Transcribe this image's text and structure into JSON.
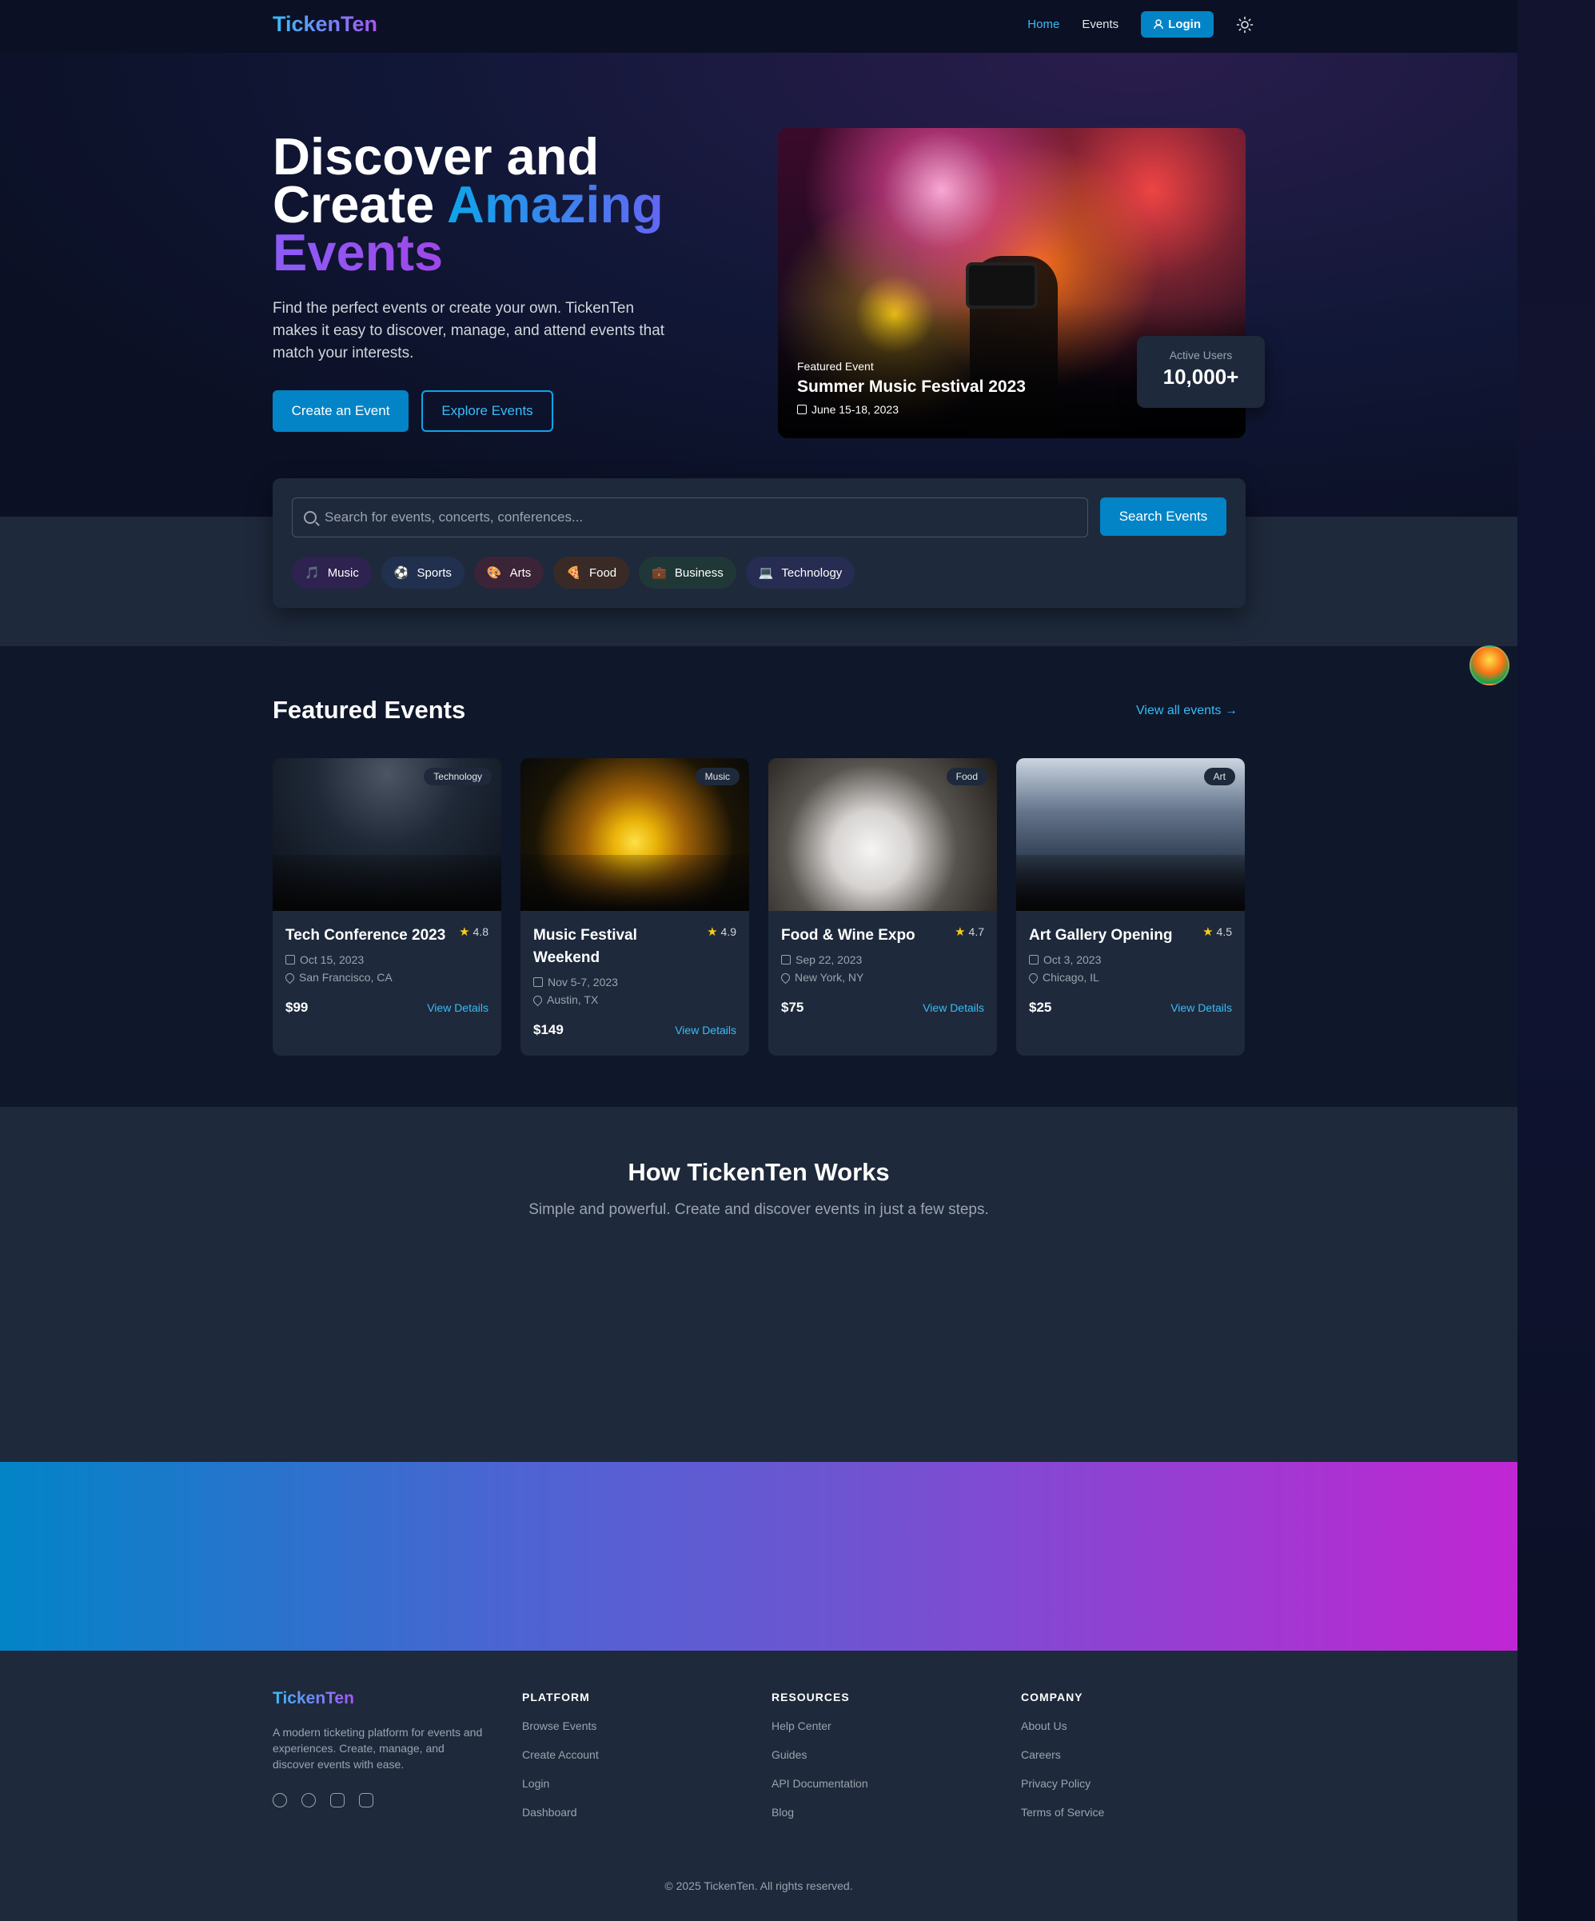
{
  "header": {
    "logo": "TickenTen",
    "nav": [
      {
        "label": "Home"
      },
      {
        "label": "Events"
      }
    ],
    "login_label": "Login"
  },
  "hero": {
    "title_line1": "Discover and",
    "title_line2a": "Create",
    "title_line2b": "Amazing",
    "title_line3": "Events",
    "description": "Find the perfect events or create your own. TickenTen makes it easy to discover, manage, and attend events that match your interests.",
    "create_label": "Create an Event",
    "explore_label": "Explore Events",
    "featured": {
      "label": "Featured Event",
      "name": "Summer Music Festival 2023",
      "date": "June 15-18, 2023"
    },
    "users": {
      "label": "Active Users",
      "count": "10,000+"
    }
  },
  "search": {
    "placeholder": "Search for events, concerts, conferences...",
    "button_label": "Search Events",
    "categories": [
      {
        "emoji": "🎵",
        "label": "Music",
        "color": "#2e2250"
      },
      {
        "emoji": "⚽",
        "label": "Sports",
        "color": "#22304f"
      },
      {
        "emoji": "🎨",
        "label": "Arts",
        "color": "#3b2338"
      },
      {
        "emoji": "🍕",
        "label": "Food",
        "color": "#3a2a26"
      },
      {
        "emoji": "💼",
        "label": "Business",
        "color": "#1f3837"
      },
      {
        "emoji": "💻",
        "label": "Technology",
        "color": "#262c52"
      }
    ]
  },
  "featured": {
    "title": "Featured Events",
    "view_all": "View all events →",
    "events": [
      {
        "title": "Tech Conference 2023",
        "category": "Technology",
        "rating": "4.8",
        "date": "Oct 15, 2023",
        "location": "San Francisco, CA",
        "price": "$99",
        "cta": "View Details"
      },
      {
        "title": "Music Festival Weekend",
        "category": "Music",
        "rating": "4.9",
        "date": "Nov 5-7, 2023",
        "location": "Austin, TX",
        "price": "$149",
        "cta": "View Details"
      },
      {
        "title": "Food & Wine Expo",
        "category": "Food",
        "rating": "4.7",
        "date": "Sep 22, 2023",
        "location": "New York, NY",
        "price": "$75",
        "cta": "View Details"
      },
      {
        "title": "Art Gallery Opening",
        "category": "Art",
        "rating": "4.5",
        "date": "Oct 3, 2023",
        "location": "Chicago, IL",
        "price": "$25",
        "cta": "View Details"
      }
    ]
  },
  "how": {
    "title": "How TickenTen Works",
    "subtitle": "Simple and powerful. Create and discover events in just a few steps."
  },
  "footer": {
    "logo": "TickenTen",
    "description": "A modern ticketing platform for events and experiences. Create, manage, and discover events with ease.",
    "columns": [
      {
        "title": "PLATFORM",
        "links": [
          "Browse Events",
          "Create Account",
          "Login",
          "Dashboard"
        ]
      },
      {
        "title": "RESOURCES",
        "links": [
          "Help Center",
          "Guides",
          "API Documentation",
          "Blog"
        ]
      },
      {
        "title": "COMPANY",
        "links": [
          "About Us",
          "Careers",
          "Privacy Policy",
          "Terms of Service"
        ]
      }
    ],
    "copyright": "© 2025 TickenTen. All rights reserved."
  }
}
